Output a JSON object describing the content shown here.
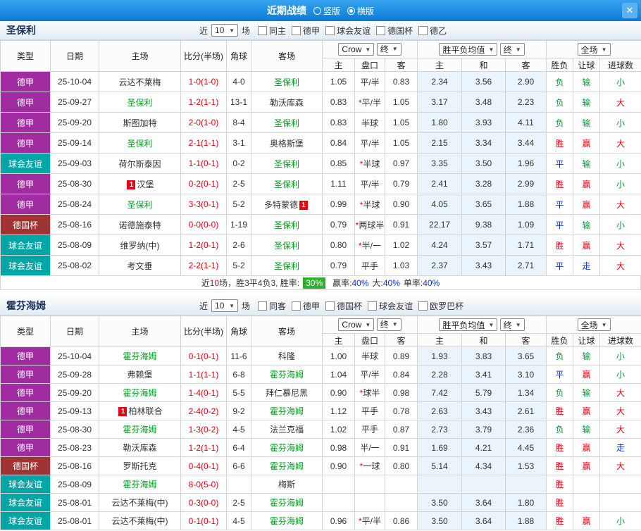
{
  "titlebar": {
    "title": "近期战绩",
    "close_icon": "✕",
    "view_options": [
      {
        "label": "竖版",
        "selected": false
      },
      {
        "label": "横版",
        "selected": true
      }
    ]
  },
  "league_colors": {
    "德甲": "#a12ba1",
    "球会友谊": "#00a6a6",
    "德国杯": "#a03434"
  },
  "result_colors": {
    "胜": "#e60012",
    "赢": "#e60012",
    "大": "#e60012",
    "负": "#009933",
    "输": "#009933",
    "小": "#009933",
    "平": "#1130c7",
    "走": "#1130c7"
  },
  "sections": [
    {
      "team": "圣保利",
      "filter": {
        "near_label": "近",
        "games_count": "10",
        "games_label": "场",
        "checkboxes": [
          "同主",
          "德甲",
          "球会友谊",
          "德国杯",
          "德乙"
        ]
      },
      "header": {
        "type": "类型",
        "date": "日期",
        "home": "主场",
        "score": "比分(半场)",
        "corner": "角球",
        "away": "客场",
        "odds_source": "Crow",
        "odds_final": "终",
        "mean_label": "胜平负均值",
        "mean_final": "终",
        "full_label": "全场",
        "sub": [
          "主",
          "盘口",
          "客",
          "主",
          "和",
          "客",
          "胜负",
          "让球",
          "进球数"
        ]
      },
      "rows": [
        {
          "league": "德甲",
          "date": "25-10-04",
          "home": "云达不莱梅",
          "away": "圣保利",
          "away_focus": true,
          "score": "1-0(1-0)",
          "corner": "4-0",
          "odds": [
            "1.05",
            "平/半",
            "0.83"
          ],
          "mean": [
            "2.34",
            "3.56",
            "2.90"
          ],
          "result": [
            "负",
            "输",
            "小"
          ]
        },
        {
          "league": "德甲",
          "date": "25-09-27",
          "home": "圣保利",
          "home_focus": true,
          "away": "勒沃库森",
          "score": "1-2(1-1)",
          "corner": "13-1",
          "odds": [
            "0.83",
            "*平/半",
            "1.05"
          ],
          "mean": [
            "3.17",
            "3.48",
            "2.23"
          ],
          "result": [
            "负",
            "输",
            "大"
          ]
        },
        {
          "league": "德甲",
          "date": "25-09-20",
          "home": "斯图加特",
          "away": "圣保利",
          "away_focus": true,
          "score": "2-0(1-0)",
          "corner": "8-4",
          "odds": [
            "0.83",
            "半球",
            "1.05"
          ],
          "mean": [
            "1.80",
            "3.93",
            "4.11"
          ],
          "result": [
            "负",
            "输",
            "小"
          ]
        },
        {
          "league": "德甲",
          "date": "25-09-14",
          "home": "圣保利",
          "home_focus": true,
          "away": "奥格斯堡",
          "score": "2-1(1-1)",
          "corner": "3-1",
          "odds": [
            "0.84",
            "平/半",
            "1.05"
          ],
          "mean": [
            "2.15",
            "3.34",
            "3.44"
          ],
          "result": [
            "胜",
            "赢",
            "大"
          ]
        },
        {
          "league": "球会友谊",
          "date": "25-09-03",
          "home": "荷尔斯泰因",
          "away": "圣保利",
          "away_focus": true,
          "score": "1-1(0-1)",
          "corner": "0-2",
          "odds": [
            "0.85",
            "*半球",
            "0.97"
          ],
          "mean": [
            "3.35",
            "3.50",
            "1.96"
          ],
          "result": [
            "平",
            "输",
            "小"
          ]
        },
        {
          "league": "德甲",
          "date": "25-08-30",
          "home": "汉堡",
          "home_badge_pre": "1",
          "away": "圣保利",
          "away_focus": true,
          "score": "0-2(0-1)",
          "corner": "2-5",
          "odds": [
            "1.11",
            "平/半",
            "0.79"
          ],
          "mean": [
            "2.41",
            "3.28",
            "2.99"
          ],
          "result": [
            "胜",
            "赢",
            "小"
          ]
        },
        {
          "league": "德甲",
          "date": "25-08-24",
          "home": "圣保利",
          "home_focus": true,
          "away": "多特蒙德",
          "away_badge_post": "1",
          "score": "3-3(0-1)",
          "corner": "5-2",
          "odds": [
            "0.99",
            "*半球",
            "0.90"
          ],
          "mean": [
            "4.05",
            "3.65",
            "1.88"
          ],
          "result": [
            "平",
            "赢",
            "大"
          ]
        },
        {
          "league": "德国杯",
          "date": "25-08-16",
          "home": "诺德施泰特",
          "away": "圣保利",
          "away_focus": true,
          "score": "0-0(0-0)",
          "corner": "1-19",
          "odds": [
            "0.79",
            "*两球半",
            "0.91"
          ],
          "mean": [
            "22.17",
            "9.38",
            "1.09"
          ],
          "result": [
            "平",
            "输",
            "小"
          ]
        },
        {
          "league": "球会友谊",
          "date": "25-08-09",
          "home": "维罗纳(中)",
          "away": "圣保利",
          "away_focus": true,
          "score": "1-2(0-1)",
          "corner": "2-6",
          "odds": [
            "0.80",
            "*半/一",
            "1.02"
          ],
          "mean": [
            "4.24",
            "3.57",
            "1.71"
          ],
          "result": [
            "胜",
            "赢",
            "大"
          ]
        },
        {
          "league": "球会友谊",
          "date": "25-08-02",
          "home": "考文垂",
          "away": "圣保利",
          "away_focus": true,
          "score": "2-2(1-1)",
          "corner": "5-2",
          "odds": [
            "0.79",
            "平手",
            "1.03"
          ],
          "mean": [
            "2.37",
            "3.43",
            "2.71"
          ],
          "result": [
            "平",
            "走",
            "大"
          ]
        }
      ],
      "summary": {
        "prefix": "近",
        "count": "10",
        "mid": "场，胜3平4负3, 胜率: ",
        "win_rate": "30%",
        "labels": [
          {
            "label": "赢率:",
            "value": "40%"
          },
          {
            "label": "大:",
            "value": "40%"
          },
          {
            "label": "单率:",
            "value": "40%"
          }
        ]
      }
    },
    {
      "team": "霍芬海姆",
      "filter": {
        "near_label": "近",
        "games_count": "10",
        "games_label": "场",
        "checkboxes": [
          "同客",
          "德甲",
          "德国杯",
          "球会友谊",
          "欧罗巴杯"
        ]
      },
      "header": {
        "type": "类型",
        "date": "日期",
        "home": "主场",
        "score": "比分(半场)",
        "corner": "角球",
        "away": "客场",
        "odds_source": "Crow",
        "odds_final": "终",
        "mean_label": "胜平负均值",
        "mean_final": "终",
        "full_label": "全场",
        "sub": [
          "主",
          "盘口",
          "客",
          "主",
          "和",
          "客",
          "胜负",
          "让球",
          "进球数"
        ]
      },
      "rows": [
        {
          "league": "德甲",
          "date": "25-10-04",
          "home": "霍芬海姆",
          "home_focus": true,
          "away": "科隆",
          "score": "0-1(0-1)",
          "corner": "11-6",
          "odds": [
            "1.00",
            "半球",
            "0.89"
          ],
          "mean": [
            "1.93",
            "3.83",
            "3.65"
          ],
          "result": [
            "负",
            "输",
            "小"
          ]
        },
        {
          "league": "德甲",
          "date": "25-09-28",
          "home": "弗赖堡",
          "away": "霍芬海姆",
          "away_focus": true,
          "score": "1-1(1-1)",
          "corner": "6-8",
          "odds": [
            "1.04",
            "平/半",
            "0.84"
          ],
          "mean": [
            "2.28",
            "3.41",
            "3.10"
          ],
          "result": [
            "平",
            "赢",
            "小"
          ]
        },
        {
          "league": "德甲",
          "date": "25-09-20",
          "home": "霍芬海姆",
          "home_focus": true,
          "away": "拜仁慕尼黑",
          "score": "1-4(0-1)",
          "corner": "5-5",
          "odds": [
            "0.90",
            "*球半",
            "0.98"
          ],
          "mean": [
            "7.42",
            "5.79",
            "1.34"
          ],
          "result": [
            "负",
            "输",
            "大"
          ]
        },
        {
          "league": "德甲",
          "date": "25-09-13",
          "home": "柏林联合",
          "home_badge_pre": "1",
          "away": "霍芬海姆",
          "away_focus": true,
          "score": "2-4(0-2)",
          "corner": "9-2",
          "odds": [
            "1.12",
            "平手",
            "0.78"
          ],
          "mean": [
            "2.63",
            "3.43",
            "2.61"
          ],
          "result": [
            "胜",
            "赢",
            "大"
          ]
        },
        {
          "league": "德甲",
          "date": "25-08-30",
          "home": "霍芬海姆",
          "home_focus": true,
          "away": "法兰克福",
          "score": "1-3(0-2)",
          "corner": "4-5",
          "odds": [
            "1.02",
            "平手",
            "0.87"
          ],
          "mean": [
            "2.73",
            "3.79",
            "2.36"
          ],
          "result": [
            "负",
            "输",
            "大"
          ]
        },
        {
          "league": "德甲",
          "date": "25-08-23",
          "home": "勒沃库森",
          "away": "霍芬海姆",
          "away_focus": true,
          "score": "1-2(1-1)",
          "corner": "6-4",
          "odds": [
            "0.98",
            "半/一",
            "0.91"
          ],
          "mean": [
            "1.69",
            "4.21",
            "4.45"
          ],
          "result": [
            "胜",
            "赢",
            "走"
          ]
        },
        {
          "league": "德国杯",
          "date": "25-08-16",
          "home": "罗斯托克",
          "away": "霍芬海姆",
          "away_focus": true,
          "score": "0-4(0-1)",
          "corner": "6-6",
          "odds": [
            "0.90",
            "*一球",
            "0.80"
          ],
          "mean": [
            "5.14",
            "4.34",
            "1.53"
          ],
          "result": [
            "胜",
            "赢",
            "大"
          ]
        },
        {
          "league": "球会友谊",
          "date": "25-08-09",
          "home": "霍芬海姆",
          "home_focus": true,
          "away": "梅斯",
          "score": "8-0(5-0)",
          "corner": "",
          "odds": [
            "",
            "",
            ""
          ],
          "mean": [
            "",
            "",
            ""
          ],
          "result": [
            "胜",
            "",
            ""
          ]
        },
        {
          "league": "球会友谊",
          "date": "25-08-01",
          "home": "云达不莱梅(中)",
          "away": "霍芬海姆",
          "away_focus": true,
          "score": "0-3(0-0)",
          "corner": "2-5",
          "odds": [
            "",
            "",
            ""
          ],
          "mean": [
            "3.50",
            "3.64",
            "1.80"
          ],
          "result": [
            "胜",
            "",
            ""
          ]
        },
        {
          "league": "球会友谊",
          "date": "25-08-01",
          "home": "云达不莱梅(中)",
          "away": "霍芬海姆",
          "away_focus": true,
          "score": "0-1(0-1)",
          "corner": "4-5",
          "odds": [
            "0.96",
            "*平/半",
            "0.86"
          ],
          "mean": [
            "3.50",
            "3.64",
            "1.88"
          ],
          "result": [
            "胜",
            "赢",
            "小"
          ]
        }
      ],
      "summary": null
    }
  ]
}
